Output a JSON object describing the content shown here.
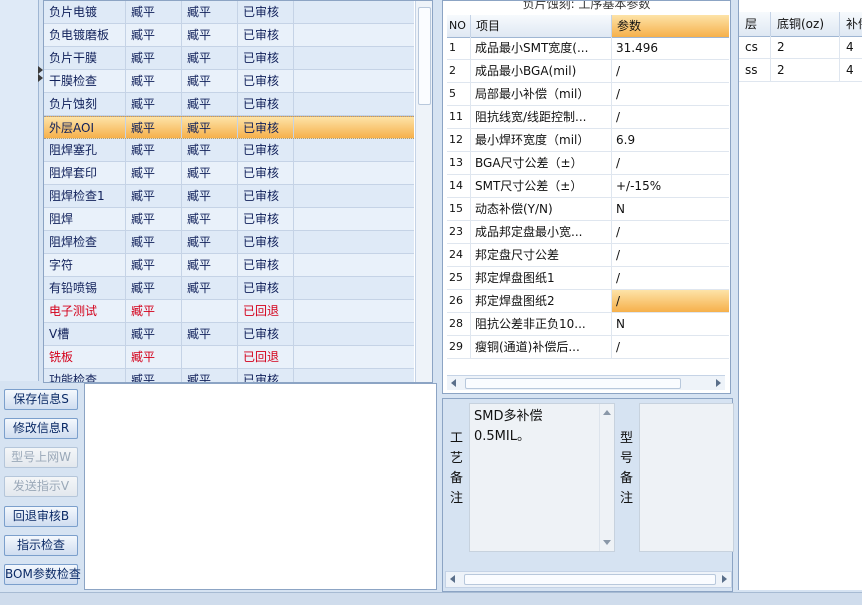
{
  "process_table": {
    "rows": [
      {
        "name": "负片电镀",
        "c2": "臧平",
        "c3": "臧平",
        "status": "已审核",
        "state": "normal"
      },
      {
        "name": "负电镀磨板",
        "c2": "臧平",
        "c3": "臧平",
        "status": "已审核",
        "state": "normal"
      },
      {
        "name": "负片干膜",
        "c2": "臧平",
        "c3": "臧平",
        "status": "已审核",
        "state": "normal"
      },
      {
        "name": "干膜检查",
        "c2": "臧平",
        "c3": "臧平",
        "status": "已审核",
        "state": "normal"
      },
      {
        "name": "负片蚀刻",
        "c2": "臧平",
        "c3": "臧平",
        "status": "已审核",
        "state": "normal"
      },
      {
        "name": "外层AOI",
        "c2": "臧平",
        "c3": "臧平",
        "status": "已审核",
        "state": "selected"
      },
      {
        "name": "阻焊塞孔",
        "c2": "臧平",
        "c3": "臧平",
        "status": "已审核",
        "state": "normal"
      },
      {
        "name": "阻焊套印",
        "c2": "臧平",
        "c3": "臧平",
        "status": "已审核",
        "state": "normal"
      },
      {
        "name": "阻焊检查1",
        "c2": "臧平",
        "c3": "臧平",
        "status": "已审核",
        "state": "normal"
      },
      {
        "name": "阻焊",
        "c2": "臧平",
        "c3": "臧平",
        "status": "已审核",
        "state": "normal"
      },
      {
        "name": "阻焊检查",
        "c2": "臧平",
        "c3": "臧平",
        "status": "已审核",
        "state": "normal"
      },
      {
        "name": "字符",
        "c2": "臧平",
        "c3": "臧平",
        "status": "已审核",
        "state": "normal"
      },
      {
        "name": "有铅喷锡",
        "c2": "臧平",
        "c3": "臧平",
        "status": "已审核",
        "state": "normal"
      },
      {
        "name": "电子测试",
        "c2": "臧平",
        "c3": "",
        "status": "已回退",
        "state": "returned"
      },
      {
        "name": "V槽",
        "c2": "臧平",
        "c3": "臧平",
        "status": "已审核",
        "state": "normal"
      },
      {
        "name": "铣板",
        "c2": "臧平",
        "c3": "",
        "status": "已回退",
        "state": "returned"
      },
      {
        "name": "功能检查",
        "c2": "臧平",
        "c3": "臧平",
        "status": "已审核",
        "state": "normal"
      }
    ]
  },
  "buttons": [
    {
      "label": "保存信息S",
      "enabled": true
    },
    {
      "label": "修改信息R",
      "enabled": true
    },
    {
      "label": "型号上网W",
      "enabled": false
    },
    {
      "label": "发送指示V",
      "enabled": false
    },
    {
      "label": "回退审核B",
      "enabled": true
    },
    {
      "label": "指示检查",
      "enabled": true
    },
    {
      "label": "BOM参数检查",
      "enabled": true
    }
  ],
  "params": {
    "title": "负片蚀刻: 工序基本参数",
    "headers": {
      "no": "NO",
      "item": "项目",
      "value": "参数"
    },
    "rows": [
      {
        "no": "1",
        "item": "成品最小SMT宽度(...",
        "value": "31.496"
      },
      {
        "no": "2",
        "item": "成品最小BGA(mil)",
        "value": "/"
      },
      {
        "no": "5",
        "item": "局部最小补偿（mil）",
        "value": "/"
      },
      {
        "no": "11",
        "item": "阻抗线宽/线距控制...",
        "value": "/"
      },
      {
        "no": "12",
        "item": "最小焊环宽度（mil）",
        "value": "6.9"
      },
      {
        "no": "13",
        "item": "BGA尺寸公差（±）",
        "value": "/"
      },
      {
        "no": "14",
        "item": "SMT尺寸公差（±）",
        "value": "+/-15%"
      },
      {
        "no": "15",
        "item": "动态补偿(Y/N)",
        "value": "N"
      },
      {
        "no": "23",
        "item": "成品邦定盘最小宽...",
        "value": "/"
      },
      {
        "no": "24",
        "item": "邦定盘尺寸公差",
        "value": "/"
      },
      {
        "no": "25",
        "item": "邦定焊盘图纸1",
        "value": "/"
      },
      {
        "no": "26",
        "item": "邦定焊盘图纸2",
        "value": "/",
        "selected": true
      },
      {
        "no": "28",
        "item": "阻抗公差非正负10...",
        "value": "N"
      },
      {
        "no": "29",
        "item": "瘦铜(通道)补偿后...",
        "value": "/"
      }
    ]
  },
  "memo": {
    "process_label": "工艺备注",
    "process_text": "SMD多补偿\n0.5MIL。",
    "type_label": "型号备注"
  },
  "copper": {
    "headers": {
      "layer": "层",
      "base": "底铜(oz)",
      "comp": "补偿"
    },
    "rows": [
      {
        "layer": "cs",
        "base": "2",
        "comp": "4"
      },
      {
        "layer": "ss",
        "base": "2",
        "comp": "4"
      }
    ]
  }
}
